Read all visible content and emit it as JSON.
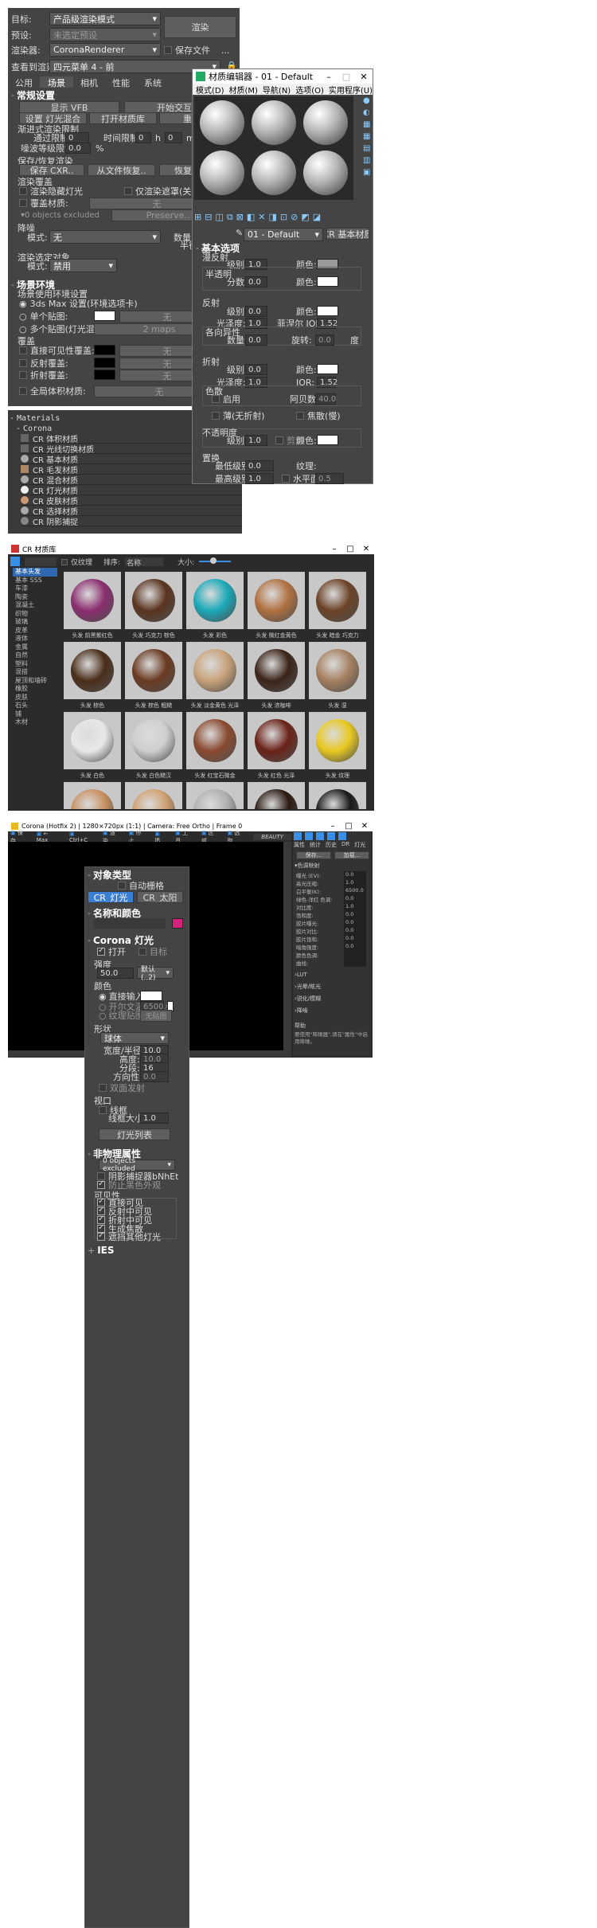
{
  "render_setup": {
    "target_label": "目标:",
    "target_value": "产品级渲染模式",
    "preset_label": "预设:",
    "preset_value": "未选定预设",
    "renderer_label": "渲染器:",
    "renderer_value": "CoronaRenderer",
    "view_label": "查看到渲染:",
    "view_value": "四元菜单 4 - 前",
    "render_button": "渲染",
    "save_file": "保存文件",
    "tabs": [
      "公用",
      "场景",
      "相机",
      "性能",
      "系统"
    ],
    "s1_title": "常规设置",
    "show_vfb": "显示 VFB",
    "interactive": "开始交互",
    "set_light_mix": "设置 灯光混合",
    "open_lib": "打开材质库",
    "reset": "重置",
    "progressive_title": "渐进式渲染限制",
    "pass_limit": "通过限制:",
    "pass_val": "0",
    "time_limit": "时间限制:",
    "time_h": "0",
    "h": "h",
    "time_m": "0",
    "m": "m",
    "noise_label": "噪波等级限制:",
    "noise_val": "0.0",
    "pct": "%",
    "save_restore_title": "保存/恢复渲染",
    "save_cxr": "保存 CXR..",
    "restore_file": "从文件恢复..",
    "restore_last": "恢复上次",
    "mtl_override_title": "渲染覆盖",
    "render_hidden": "渲染隐藏灯光",
    "only_mask": "仅渲染遮罩(关闭阴影)",
    "override_mtl": "覆盖材质:",
    "none": "无",
    "objects_excl": "0 objects excluded",
    "preserve": "Preserve..",
    "denoise_title": "降噪",
    "mode_label": "模式:",
    "mode_val": "无",
    "amount_label": "数量:",
    "radius_label": "半径:",
    "render_select_title": "渲染选定对象",
    "rs_mode_val": "禁用",
    "s2_title": "场景环境",
    "scene_env": "场景使用环境设置",
    "opt_3dsmax": "3ds Max 设置(环境选项卡)",
    "opt_single": "单个贴图:",
    "opt_multi": "多个贴图(灯光混合):",
    "maps": "2 maps",
    "override_title": "覆盖",
    "direct_vis": "直接可见性覆盖:",
    "refl_override": "反射覆盖:",
    "refr_override": "折射覆盖:",
    "global_vol": "全局体积材质:"
  },
  "materials": {
    "header": "Materials",
    "group": "Corona",
    "items": [
      "CR 体积材质",
      "CR 光线切换材质",
      "CR 基本材质",
      "CR 毛发材质",
      "CR 混合材质",
      "CR 灯光材质",
      "CR 皮肤材质",
      "CR 选择材质",
      "CR 阴影捕捉"
    ]
  },
  "mtl_editor": {
    "title": "材质编辑器 - 01 - Default",
    "menu": [
      "模式(D)",
      "材质(M)",
      "导航(N)",
      "选项(O)",
      "实用程序(U)"
    ],
    "name": "01 - Default",
    "type": "CR 基本材质",
    "basic_title": "基本选项",
    "diffuse": "漫反射",
    "level": "级别:",
    "one": "1.0",
    "color": "颜色:",
    "translucency": "半透明",
    "fraction": "分数:",
    "zero": "0.0",
    "reflection": "反射",
    "gloss": "光泽度:",
    "fresnel": "菲涅尔 IOR:",
    "ior_val": "1.52",
    "aniso": "各向异性",
    "amount": "数量:",
    "rotation": "旋转:",
    "deg": "度",
    "refraction": "折射",
    "ior": "IOR:",
    "dispersion": "色散",
    "enable": "启用",
    "abbe": "阿贝数:",
    "abbe_val": "40.0",
    "thin": "薄(无折射)",
    "caustics": "焦散(慢)",
    "opacity": "不透明度",
    "clip": "剪切",
    "displacement": "置换",
    "min_level": "最低级别:",
    "texture": "纹理:",
    "max_level": "最高级别:",
    "water": "水平面:",
    "water_val": "0.5"
  },
  "cr_lib": {
    "title": "CR 材质库",
    "only_tex": "仅纹理",
    "sort": "排序:",
    "sort_val": "名称",
    "size": "大小:",
    "categories": [
      "基本头发",
      "基本 SSS",
      "车漆",
      "陶瓷",
      "混凝土",
      "织物",
      "玻璃",
      "皮革",
      "液体",
      "金属",
      "自然",
      "塑料",
      "混搭",
      "屋顶和墙砖",
      "橡胶",
      "皮肤",
      "石头",
      "铺",
      "木材"
    ],
    "tiles": [
      {
        "label": "头发 前黑紫红色",
        "color": "#8a2d6e"
      },
      {
        "label": "头发 巧克力 棕色",
        "color": "#5a3420"
      },
      {
        "label": "头发 彩色",
        "color": "#1aa8b8"
      },
      {
        "label": "头发 微红金黄色",
        "color": "#b07040"
      },
      {
        "label": "头发 暗金 巧克力",
        "color": "#6b4226"
      },
      {
        "label": "头发 棕色",
        "color": "#4a2e1a"
      },
      {
        "label": "头发 棕色 粗糙",
        "color": "#6a3a22"
      },
      {
        "label": "头发 淡金黄色 光泽",
        "color": "#c8a27a"
      },
      {
        "label": "头发 浓咖啡",
        "color": "#3b2418"
      },
      {
        "label": "头发 湿",
        "color": "#a58060"
      },
      {
        "label": "头发 白色",
        "color": "#e8e8e8"
      },
      {
        "label": "头发 白色糙汉",
        "color": "#cfcfcf"
      },
      {
        "label": "头发 红宝石微金",
        "color": "#8a4a30"
      },
      {
        "label": "头发 红色 光泽",
        "color": "#6a2218"
      },
      {
        "label": "头发 纹理",
        "color": "#e8c820"
      },
      {
        "label": "",
        "color": "#c89060"
      },
      {
        "label": "",
        "color": "#d0a070"
      },
      {
        "label": "",
        "color": "#b0b0b0"
      },
      {
        "label": "",
        "color": "#2a1a12"
      },
      {
        "label": "",
        "color": "#1a1a1a"
      }
    ]
  },
  "vfb": {
    "title": "Corona (Hotfix 2) | 1280×720px (1:1) | Camera: Free Ortho | Frame 0",
    "toolbar": [
      "保存",
      "← Max",
      "Ctrl+C",
      "渲染",
      "停止",
      "IR",
      "工具",
      "区域",
      "选取",
      "BEAUTY"
    ],
    "right_tabs": [
      "属性",
      "统计",
      "历史",
      "DR",
      "灯光"
    ],
    "save_btn": "保存...",
    "load_btn": "加载...",
    "post_title": "色调映射",
    "post_rows": [
      [
        "曝光 (EV):",
        "0.0"
      ],
      [
        "高光压缩:",
        "1.0"
      ],
      [
        "白平衡(K):",
        "6500.0"
      ],
      [
        "绿色-洋红 色调:",
        "0.0"
      ],
      [
        "对比度:",
        "1.0"
      ],
      [
        "饱和度:",
        "0.0"
      ],
      [
        "胶片曝光:",
        "0.0"
      ],
      [
        "胶片对比:",
        "0.0"
      ],
      [
        "胶片饱和:",
        "0.0"
      ],
      [
        "暗角强度:",
        "0.0"
      ],
      [
        "颜色色调:",
        ""
      ],
      [
        "曲线:",
        ""
      ]
    ],
    "sections": [
      "LUT",
      "光晕/眩光",
      "锐化/模糊",
      "降噪"
    ],
    "help_title": "帮助",
    "help_text": "要使用\"降噪器\",请在\"属性\"中启用降噪。"
  },
  "light": {
    "obj_type": "对象类型",
    "auto_grid": "自动栅格",
    "btn_light": "CR_灯光",
    "btn_sun": "CR_太阳",
    "name_color": "名称和颜色",
    "corona_light": "Corona 灯光",
    "on": "打开",
    "target": "目标",
    "intensity": "强度",
    "int_val": "50.0",
    "unit_val": "默认(..2)",
    "color": "颜色",
    "direct": "直接输入:",
    "kelvin": "开尔文温度",
    "kelvin_val": "6500.0",
    "tex_map": "纹理贴图:",
    "no_map": "无贴图",
    "shape": "形状",
    "shape_val": "球体",
    "width": "宽度/半径:",
    "w_val": "10.0",
    "height": "高度:",
    "h_val": "10.0",
    "segments": "分段:",
    "seg_val": "16",
    "directionality": "方向性:",
    "dir_val": "0.0",
    "double": "双面发射",
    "viewport": "视口",
    "wireframe": "线框",
    "wire_size": "线框大小:",
    "wire_val": "1.0",
    "light_list": "灯光列表",
    "nonphys": "非物理属性",
    "excluded": "0 objects excluded",
    "shadow_catch": "阴影捕捉器bNhEt",
    "prevent_black": "防止黑色外观",
    "visibility": "可见性",
    "vis_items": [
      "直接可见",
      "反射中可见",
      "折射中可见",
      "生成焦散",
      "遮挡其他灯光"
    ],
    "ies": "IES"
  }
}
